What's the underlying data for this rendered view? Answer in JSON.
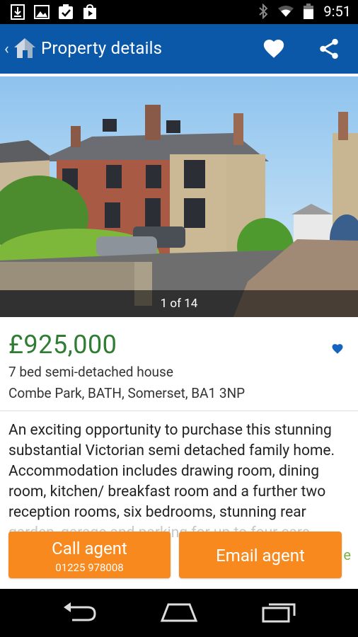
{
  "status_bar": {
    "time": "9:51",
    "left_icons": [
      "download-icon",
      "image-icon",
      "clipboard-check-icon",
      "play-store-icon"
    ],
    "right_icons": [
      "bluetooth-icon",
      "wifi-icon",
      "battery-icon"
    ]
  },
  "app_bar": {
    "title": "Property details",
    "actions": [
      "favorite-heart-icon",
      "share-icon"
    ]
  },
  "gallery": {
    "counter": "1 of 14"
  },
  "listing": {
    "price": "£925,000",
    "type": "7 bed semi-detached house",
    "address": "Combe Park, BATH, Somerset, BA1 3NP",
    "description": "An exciting opportunity to purchase this stunning substantial Victorian semi detached family home. Accommodation includes drawing room, dining room, kitchen/ breakfast room and a further two reception rooms, six bedrooms, stunning rear garden, garage and parking for up to four cars."
  },
  "actions": {
    "call_label": "Call agent",
    "call_phone": "01225 978008",
    "email_label": "Email agent",
    "more_hint": "e"
  },
  "colors": {
    "app_bar": "#0b57a8",
    "price_green": "#2e7d32",
    "button_orange": "#f7891f",
    "heart_blue": "#1565c0"
  }
}
